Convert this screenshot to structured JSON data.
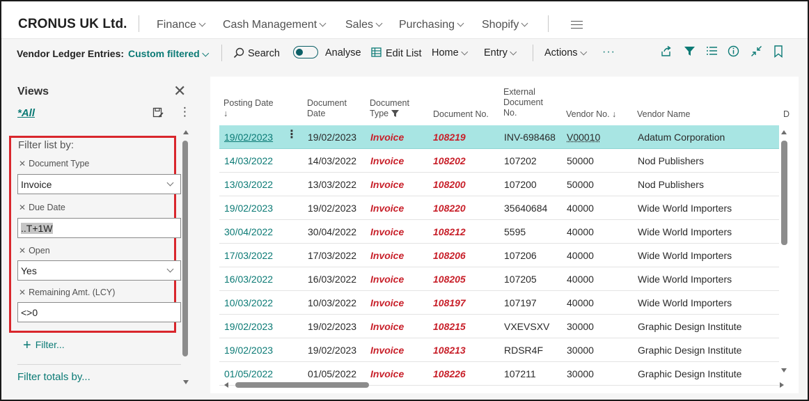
{
  "company": "CRONUS UK Ltd.",
  "nav": {
    "finance": "Finance",
    "cash_management": "Cash Management",
    "sales": "Sales",
    "purchasing": "Purchasing",
    "shopify": "Shopify"
  },
  "actionbar": {
    "page_name": "Vendor Ledger Entries:",
    "view": "Custom filtered",
    "search": "Search",
    "analyse": "Analyse",
    "edit_list": "Edit List",
    "home": "Home",
    "entry": "Entry",
    "actions": "Actions",
    "more": "···"
  },
  "views": {
    "title": "Views",
    "all": "*All",
    "filter_list_by": "Filter list by:",
    "filters": [
      {
        "label": "Document Type",
        "value": "Invoice"
      },
      {
        "label": "Due Date",
        "value": "..T+1W"
      },
      {
        "label": "Open",
        "value": "Yes"
      },
      {
        "label": "Remaining Amt. (LCY)",
        "value": "<>0"
      }
    ],
    "add_filter": "Filter...",
    "filter_totals_by": "Filter totals by..."
  },
  "columns": {
    "posting_date": "Posting Date",
    "posting_date_sort": "↓",
    "document_date_1": "Document",
    "document_date_2": "Date",
    "document_type_1": "Document",
    "document_type_2": "Type",
    "document_no": "Document No.",
    "external_1": "External",
    "external_2": "Document",
    "external_3": "No.",
    "vendor_no": "Vendor No.",
    "vendor_no_sort": "↓",
    "vendor_name": "Vendor Name",
    "next_col": "D"
  },
  "rows": [
    {
      "posting_date": "19/02/2023",
      "document_date": "19/02/2023",
      "document_type": "Invoice",
      "document_no": "108219",
      "external_no": "INV-698468",
      "vendor_no": "V00010",
      "vendor_name": "Adatum Corporation"
    },
    {
      "posting_date": "14/03/2022",
      "document_date": "14/03/2022",
      "document_type": "Invoice",
      "document_no": "108202",
      "external_no": "107202",
      "vendor_no": "50000",
      "vendor_name": "Nod Publishers"
    },
    {
      "posting_date": "13/03/2022",
      "document_date": "13/03/2022",
      "document_type": "Invoice",
      "document_no": "108200",
      "external_no": "107200",
      "vendor_no": "50000",
      "vendor_name": "Nod Publishers"
    },
    {
      "posting_date": "19/02/2023",
      "document_date": "19/02/2023",
      "document_type": "Invoice",
      "document_no": "108220",
      "external_no": "35640684",
      "vendor_no": "40000",
      "vendor_name": "Wide World Importers"
    },
    {
      "posting_date": "30/04/2022",
      "document_date": "30/04/2022",
      "document_type": "Invoice",
      "document_no": "108212",
      "external_no": "5595",
      "vendor_no": "40000",
      "vendor_name": "Wide World Importers"
    },
    {
      "posting_date": "17/03/2022",
      "document_date": "17/03/2022",
      "document_type": "Invoice",
      "document_no": "108206",
      "external_no": "107206",
      "vendor_no": "40000",
      "vendor_name": "Wide World Importers"
    },
    {
      "posting_date": "16/03/2022",
      "document_date": "16/03/2022",
      "document_type": "Invoice",
      "document_no": "108205",
      "external_no": "107205",
      "vendor_no": "40000",
      "vendor_name": "Wide World Importers"
    },
    {
      "posting_date": "10/03/2022",
      "document_date": "10/03/2022",
      "document_type": "Invoice",
      "document_no": "108197",
      "external_no": "107197",
      "vendor_no": "40000",
      "vendor_name": "Wide World Importers"
    },
    {
      "posting_date": "19/02/2023",
      "document_date": "19/02/2023",
      "document_type": "Invoice",
      "document_no": "108215",
      "external_no": "VXEVSXV",
      "vendor_no": "30000",
      "vendor_name": "Graphic Design Institute"
    },
    {
      "posting_date": "19/02/2023",
      "document_date": "19/02/2023",
      "document_type": "Invoice",
      "document_no": "108213",
      "external_no": "RDSR4F",
      "vendor_no": "30000",
      "vendor_name": "Graphic Design Institute"
    },
    {
      "posting_date": "01/05/2022",
      "document_date": "01/05/2022",
      "document_type": "Invoice",
      "document_no": "108226",
      "external_no": "107211",
      "vendor_no": "30000",
      "vendor_name": "Graphic Design Institute"
    }
  ],
  "colors": {
    "accent": "#0b7a75",
    "document_red": "#c8202a",
    "selected_row": "#a8e5e3",
    "highlight_box": "#d9262c"
  }
}
